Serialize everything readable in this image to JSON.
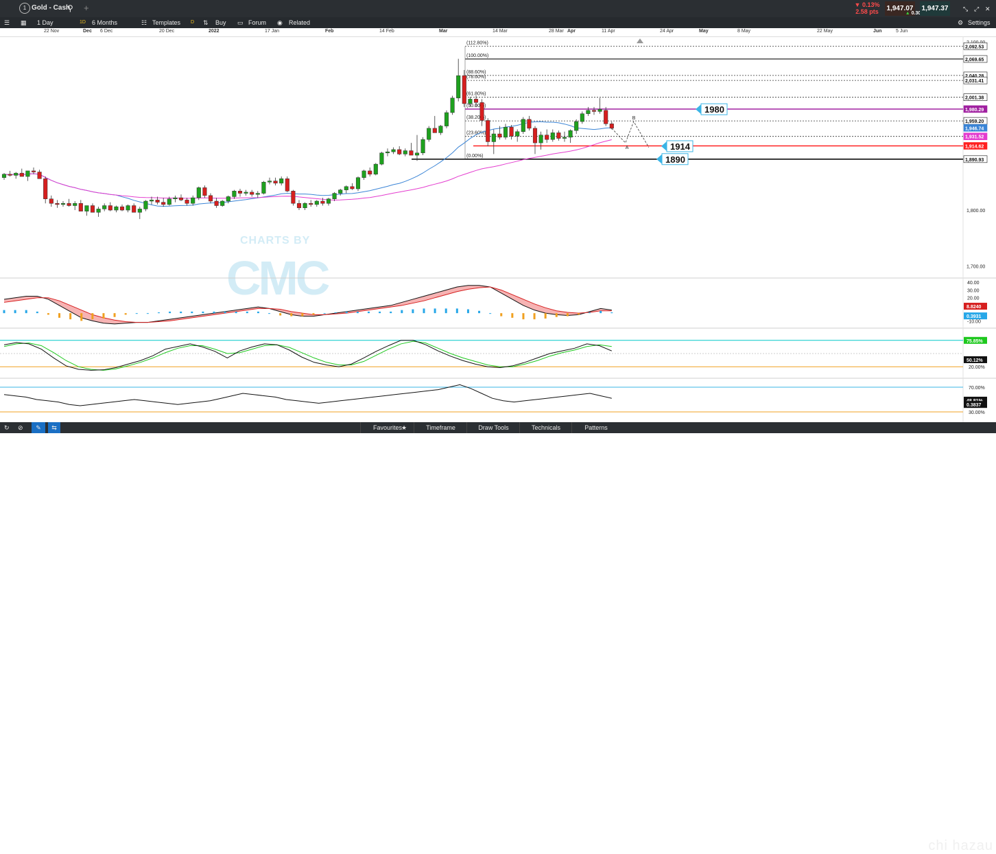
{
  "header": {
    "instrument": "Gold - Cash",
    "change_pct": "▼ 0.13%",
    "change_pts": "2.58 pts",
    "sell_price": "1,947.07",
    "spread": "0.30",
    "buy_price": "1,947.37"
  },
  "toolbar": {
    "interval": "1 Day",
    "interval_badge": "1D",
    "range": "6 Months",
    "templates": "Templates",
    "d_badge": "D",
    "buy": "Buy",
    "forum": "Forum",
    "related": "Related",
    "settings": "Settings"
  },
  "date_axis": [
    "22 Nov",
    "Dec",
    "6 Dec",
    "20 Dec",
    "2022",
    "17 Jan",
    "Feb",
    "14 Feb",
    "Mar",
    "14 Mar",
    "28 Mar",
    "Apr",
    "11 Apr",
    "24 Apr",
    "May",
    "8 May",
    "22 May",
    "Jun",
    "5 Jun"
  ],
  "watermark": {
    "line1": "CHARTS BY",
    "line2": "CMC"
  },
  "bottom_menu": [
    "Favourites",
    "Timeframe",
    "Draw Tools",
    "Technicals",
    "Patterns"
  ],
  "corner_text": "chi hazau",
  "colors": {
    "up": "#1ea11e",
    "down": "#d61f1f",
    "ma_fast": "#3a84d6",
    "ma_slow": "#e43ccf",
    "support1": "#ff2020",
    "support2": "#000000",
    "resistance": "#a020a0",
    "stoch_k": "#00a300",
    "stoch_line": "#00c8c8",
    "rsi_ref": "#f0a020"
  },
  "chart_data": [
    {
      "type": "candlestick",
      "title": "Gold - Cash",
      "price_axis_ticks": [
        "1,700.00",
        "1,800.00",
        "2,100.00"
      ],
      "ylim": [
        1680,
        2110
      ],
      "moving_averages": [
        {
          "name": "fast",
          "color": "#3a84d6"
        },
        {
          "name": "slow",
          "color": "#e43ccf"
        }
      ],
      "fibonacci_levels": [
        {
          "label": "(112.80%)",
          "price": "2,092.53"
        },
        {
          "label": "(100.00%)",
          "price": "2,069.65"
        },
        {
          "label": "(88.60%)",
          "price": "2,040.28"
        },
        {
          "label": "(78.60%)",
          "price": "2,031.41"
        },
        {
          "label": "(61.80%)",
          "price": "2,001.38"
        },
        {
          "label": "(50.00%)",
          "price": "1,980.29"
        },
        {
          "label": "(38.20%)",
          "price": "1,959.20"
        },
        {
          "label": "(23.60%)",
          "price": "1,931.52"
        },
        {
          "label": "(0.00%)",
          "price": "1,890.93"
        }
      ],
      "price_tags": [
        {
          "text": "2,092.53",
          "kind": "fib"
        },
        {
          "text": "2,069.65",
          "kind": "fib"
        },
        {
          "text": "2,040.28",
          "kind": "fib"
        },
        {
          "text": "2,031.41",
          "kind": "fib"
        },
        {
          "text": "2,001.38",
          "kind": "fib"
        },
        {
          "text": "1,980.29",
          "kind": "resistance"
        },
        {
          "text": "1,959.20",
          "kind": "fib"
        },
        {
          "text": "1,946.74",
          "kind": "ma_fast"
        },
        {
          "text": "1,931.52",
          "kind": "ma_slow"
        },
        {
          "text": "1,914.62",
          "kind": "support"
        },
        {
          "text": "1,890.93",
          "kind": "fib"
        }
      ],
      "annotations": [
        {
          "text": "1980",
          "price": 1980
        },
        {
          "text": "1914",
          "price": 1914
        },
        {
          "text": "1890",
          "price": 1891
        }
      ],
      "projection_labels": [
        "A",
        "B"
      ],
      "candles": [
        [
          1858,
          1866,
          1854,
          1864
        ],
        [
          1864,
          1870,
          1860,
          1862
        ],
        [
          1862,
          1868,
          1856,
          1866
        ],
        [
          1866,
          1874,
          1862,
          1860
        ],
        [
          1860,
          1866,
          1852,
          1870
        ],
        [
          1870,
          1876,
          1864,
          1868
        ],
        [
          1868,
          1872,
          1858,
          1856
        ],
        [
          1856,
          1860,
          1812,
          1820
        ],
        [
          1820,
          1826,
          1806,
          1812
        ],
        [
          1812,
          1818,
          1804,
          1810
        ],
        [
          1810,
          1816,
          1806,
          1812
        ],
        [
          1812,
          1820,
          1806,
          1808
        ],
        [
          1808,
          1816,
          1800,
          1812
        ],
        [
          1812,
          1818,
          1802,
          1798
        ],
        [
          1798,
          1806,
          1790,
          1808
        ],
        [
          1808,
          1812,
          1796,
          1796
        ],
        [
          1796,
          1806,
          1788,
          1802
        ],
        [
          1802,
          1812,
          1798,
          1808
        ],
        [
          1808,
          1814,
          1798,
          1800
        ],
        [
          1800,
          1808,
          1796,
          1806
        ],
        [
          1806,
          1810,
          1798,
          1800
        ],
        [
          1800,
          1810,
          1796,
          1808
        ],
        [
          1808,
          1812,
          1798,
          1796
        ],
        [
          1796,
          1806,
          1784,
          1802
        ],
        [
          1802,
          1818,
          1798,
          1816
        ],
        [
          1816,
          1824,
          1810,
          1818
        ],
        [
          1818,
          1824,
          1810,
          1814
        ],
        [
          1814,
          1822,
          1806,
          1810
        ],
        [
          1810,
          1824,
          1808,
          1820
        ],
        [
          1820,
          1826,
          1814,
          1822
        ],
        [
          1822,
          1828,
          1816,
          1818
        ],
        [
          1818,
          1822,
          1808,
          1812
        ],
        [
          1812,
          1826,
          1808,
          1822
        ],
        [
          1822,
          1842,
          1818,
          1840
        ],
        [
          1840,
          1844,
          1822,
          1826
        ],
        [
          1826,
          1830,
          1812,
          1816
        ],
        [
          1816,
          1822,
          1804,
          1808
        ],
        [
          1808,
          1818,
          1806,
          1816
        ],
        [
          1816,
          1826,
          1812,
          1824
        ],
        [
          1824,
          1836,
          1820,
          1834
        ],
        [
          1834,
          1838,
          1824,
          1830
        ],
        [
          1830,
          1836,
          1826,
          1832
        ],
        [
          1832,
          1836,
          1824,
          1828
        ],
        [
          1828,
          1834,
          1822,
          1830
        ],
        [
          1830,
          1852,
          1828,
          1850
        ],
        [
          1850,
          1858,
          1846,
          1852
        ],
        [
          1852,
          1858,
          1844,
          1848
        ],
        [
          1848,
          1860,
          1844,
          1856
        ],
        [
          1856,
          1860,
          1832,
          1834
        ],
        [
          1834,
          1836,
          1808,
          1812
        ],
        [
          1812,
          1818,
          1800,
          1804
        ],
        [
          1804,
          1814,
          1800,
          1812
        ],
        [
          1812,
          1818,
          1806,
          1810
        ],
        [
          1810,
          1818,
          1806,
          1816
        ],
        [
          1816,
          1822,
          1808,
          1812
        ],
        [
          1812,
          1822,
          1808,
          1820
        ],
        [
          1820,
          1832,
          1816,
          1830
        ],
        [
          1830,
          1838,
          1826,
          1836
        ],
        [
          1836,
          1844,
          1830,
          1842
        ],
        [
          1842,
          1848,
          1836,
          1838
        ],
        [
          1838,
          1860,
          1834,
          1858
        ],
        [
          1858,
          1872,
          1854,
          1870
        ],
        [
          1870,
          1876,
          1860,
          1864
        ],
        [
          1864,
          1884,
          1862,
          1882
        ],
        [
          1882,
          1904,
          1880,
          1902
        ],
        [
          1902,
          1910,
          1896,
          1904
        ],
        [
          1904,
          1912,
          1900,
          1908
        ],
        [
          1908,
          1914,
          1898,
          1900
        ],
        [
          1900,
          1910,
          1896,
          1906
        ],
        [
          1906,
          1920,
          1900,
          1898
        ],
        [
          1898,
          1934,
          1888,
          1902
        ],
        [
          1902,
          1930,
          1898,
          1926
        ],
        [
          1926,
          1950,
          1922,
          1946
        ],
        [
          1946,
          1968,
          1942,
          1938
        ],
        [
          1938,
          1952,
          1934,
          1950
        ],
        [
          1950,
          1978,
          1946,
          1974
        ],
        [
          1974,
          2004,
          1970,
          2000
        ],
        [
          2000,
          2070,
          1994,
          2040
        ],
        [
          2040,
          2050,
          1984,
          1990
        ],
        [
          1990,
          2002,
          1984,
          1998
        ],
        [
          1998,
          2004,
          1984,
          1992
        ],
        [
          1992,
          1998,
          1950,
          1960
        ],
        [
          1960,
          1964,
          1914,
          1922
        ],
        [
          1922,
          1944,
          1900,
          1936
        ],
        [
          1936,
          1950,
          1926,
          1930
        ],
        [
          1930,
          1954,
          1926,
          1948
        ],
        [
          1948,
          1952,
          1926,
          1932
        ],
        [
          1932,
          1944,
          1922,
          1940
        ],
        [
          1940,
          1966,
          1936,
          1962
        ],
        [
          1962,
          1968,
          1942,
          1946
        ],
        [
          1946,
          1950,
          1900,
          1920
        ],
        [
          1920,
          1940,
          1908,
          1934
        ],
        [
          1934,
          1944,
          1920,
          1926
        ],
        [
          1926,
          1944,
          1922,
          1938
        ],
        [
          1938,
          1942,
          1924,
          1928
        ],
        [
          1928,
          1940,
          1922,
          1930
        ],
        [
          1930,
          1944,
          1920,
          1942
        ],
        [
          1942,
          1962,
          1936,
          1958
        ],
        [
          1958,
          1976,
          1954,
          1972
        ],
        [
          1972,
          1984,
          1968,
          1978
        ],
        [
          1978,
          1984,
          1970,
          1976
        ],
        [
          1976,
          2000,
          1972,
          1980
        ],
        [
          1978,
          1984,
          1950,
          1954
        ],
        [
          1954,
          1958,
          1944,
          1946
        ]
      ]
    },
    {
      "type": "macd",
      "ticks": [
        "40.00",
        "30.00",
        "20.00",
        "-10.00"
      ],
      "value_tags": [
        "8.8240",
        "0.3931"
      ],
      "line_a": [
        18,
        20,
        22,
        22,
        18,
        10,
        2,
        -6,
        -10,
        -13,
        -14,
        -13,
        -12,
        -12,
        -10,
        -8,
        -6,
        -4,
        -2,
        0,
        2,
        4,
        6,
        8,
        6,
        2,
        -2,
        -4,
        -4,
        -2,
        0,
        2,
        4,
        6,
        8,
        10,
        14,
        18,
        22,
        26,
        30,
        34,
        36,
        36,
        34,
        26,
        18,
        10,
        4,
        0,
        -2,
        -3,
        -2,
        2,
        6,
        4
      ],
      "line_b": [
        14,
        16,
        18,
        20,
        20,
        16,
        10,
        4,
        -2,
        -6,
        -9,
        -11,
        -12,
        -12,
        -11,
        -10,
        -8,
        -6,
        -4,
        -2,
        0,
        2,
        4,
        6,
        6,
        5,
        2,
        0,
        -2,
        -2,
        -1,
        0,
        2,
        4,
        6,
        8,
        10,
        13,
        16,
        20,
        24,
        28,
        31,
        33,
        34,
        30,
        24,
        18,
        12,
        7,
        3,
        1,
        0,
        1,
        3,
        3
      ],
      "histogram": [
        4,
        4,
        4,
        2,
        -2,
        -6,
        -8,
        -10,
        -8,
        -7,
        -5,
        -2,
        0,
        0,
        1,
        2,
        2,
        2,
        2,
        2,
        2,
        2,
        2,
        2,
        0,
        -3,
        -4,
        -4,
        -2,
        0,
        1,
        2,
        2,
        2,
        2,
        2,
        4,
        5,
        6,
        6,
        6,
        6,
        5,
        3,
        0,
        -4,
        -6,
        -8,
        -8,
        -7,
        -5,
        -4,
        -2,
        1,
        3,
        1
      ]
    },
    {
      "type": "stochastic",
      "value_tags": [
        "75.85%",
        "50.12%"
      ],
      "ticks": [
        "20.00%"
      ],
      "k": [
        70,
        75,
        72,
        60,
        40,
        22,
        14,
        12,
        13,
        18,
        26,
        34,
        45,
        60,
        66,
        72,
        65,
        55,
        40,
        56,
        65,
        72,
        70,
        58,
        42,
        30,
        24,
        20,
        26,
        40,
        55,
        68,
        80,
        80,
        70,
        56,
        44,
        34,
        26,
        20,
        18,
        22,
        30,
        40,
        50,
        56,
        62,
        72,
        68,
        56
      ],
      "d": [
        66,
        72,
        74,
        68,
        52,
        34,
        20,
        14,
        12,
        15,
        22,
        30,
        40,
        52,
        62,
        68,
        68,
        60,
        50,
        52,
        60,
        68,
        70,
        64,
        52,
        40,
        30,
        24,
        24,
        32,
        46,
        60,
        72,
        78,
        74,
        62,
        50,
        40,
        32,
        24,
        20,
        20,
        26,
        34,
        44,
        52,
        58,
        66,
        70,
        66
      ]
    },
    {
      "type": "rsi",
      "ticks": [
        "70.00%",
        "30.00%"
      ],
      "value_tags": [
        "48.81%",
        "0.3837"
      ],
      "values": [
        58,
        56,
        54,
        50,
        48,
        46,
        42,
        40,
        42,
        44,
        46,
        48,
        50,
        48,
        46,
        44,
        42,
        44,
        46,
        48,
        52,
        56,
        60,
        58,
        56,
        54,
        50,
        48,
        46,
        44,
        46,
        48,
        50,
        52,
        54,
        56,
        58,
        60,
        62,
        64,
        66,
        70,
        74,
        68,
        60,
        52,
        48,
        46,
        48,
        50,
        52,
        54,
        56,
        58,
        60,
        56,
        52
      ]
    }
  ]
}
